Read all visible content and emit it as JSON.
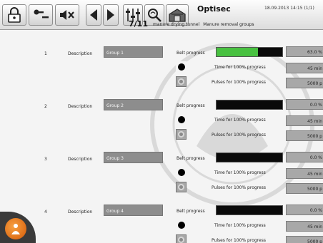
{
  "header": {
    "app_name": "Optisec",
    "datetime": "18.09.2013 14:15 (1/1)",
    "page_counter": "7/11",
    "breadcrumb": [
      "manure drying tunnel",
      "Manure removal groups"
    ]
  },
  "toolbar": {
    "buttons": [
      {
        "name": "lock-button",
        "icon": "lock-icon"
      },
      {
        "name": "login-button",
        "icon": "key-login-icon"
      },
      {
        "name": "mute-button",
        "icon": "speaker-muted-icon"
      },
      {
        "name": "previous-page-button",
        "icon": "arrow-left-icon"
      },
      {
        "name": "next-page-button",
        "icon": "arrow-right-icon"
      },
      {
        "name": "settings-sliders-button",
        "icon": "sliders-icon"
      },
      {
        "name": "alarm-search-button",
        "icon": "magnifier-icon"
      },
      {
        "name": "house-overview-button",
        "icon": "barn-icon"
      }
    ]
  },
  "labels": {
    "description": "Description",
    "belt_progress": "Belt progress",
    "time_for_100": "Time for 100% progress",
    "pulses_for_100": "Pulses for 100% progress"
  },
  "groups": [
    {
      "number": "1",
      "description": "Group 1",
      "belt_progress_value": "63.0 %",
      "belt_progress": 0.63,
      "time": "45 min",
      "pulses": "5000 p"
    },
    {
      "number": "2",
      "description": "Group 2",
      "belt_progress_value": "0.0 %",
      "belt_progress": 0.0,
      "time": "45 min",
      "pulses": "5000 p"
    },
    {
      "number": "3",
      "description": "Group 3",
      "belt_progress_value": "0.0 %",
      "belt_progress": 0.0,
      "time": "45 min",
      "pulses": "5000 p"
    },
    {
      "number": "4",
      "description": "Group 4",
      "belt_progress_value": "0.0 %",
      "belt_progress": 0.0,
      "time": "45 min",
      "pulses": "5000 p"
    }
  ],
  "colors": {
    "progress_fill": "#48c140",
    "field_grey": "#8d8d8d",
    "logo_orange": "#e8761f"
  }
}
